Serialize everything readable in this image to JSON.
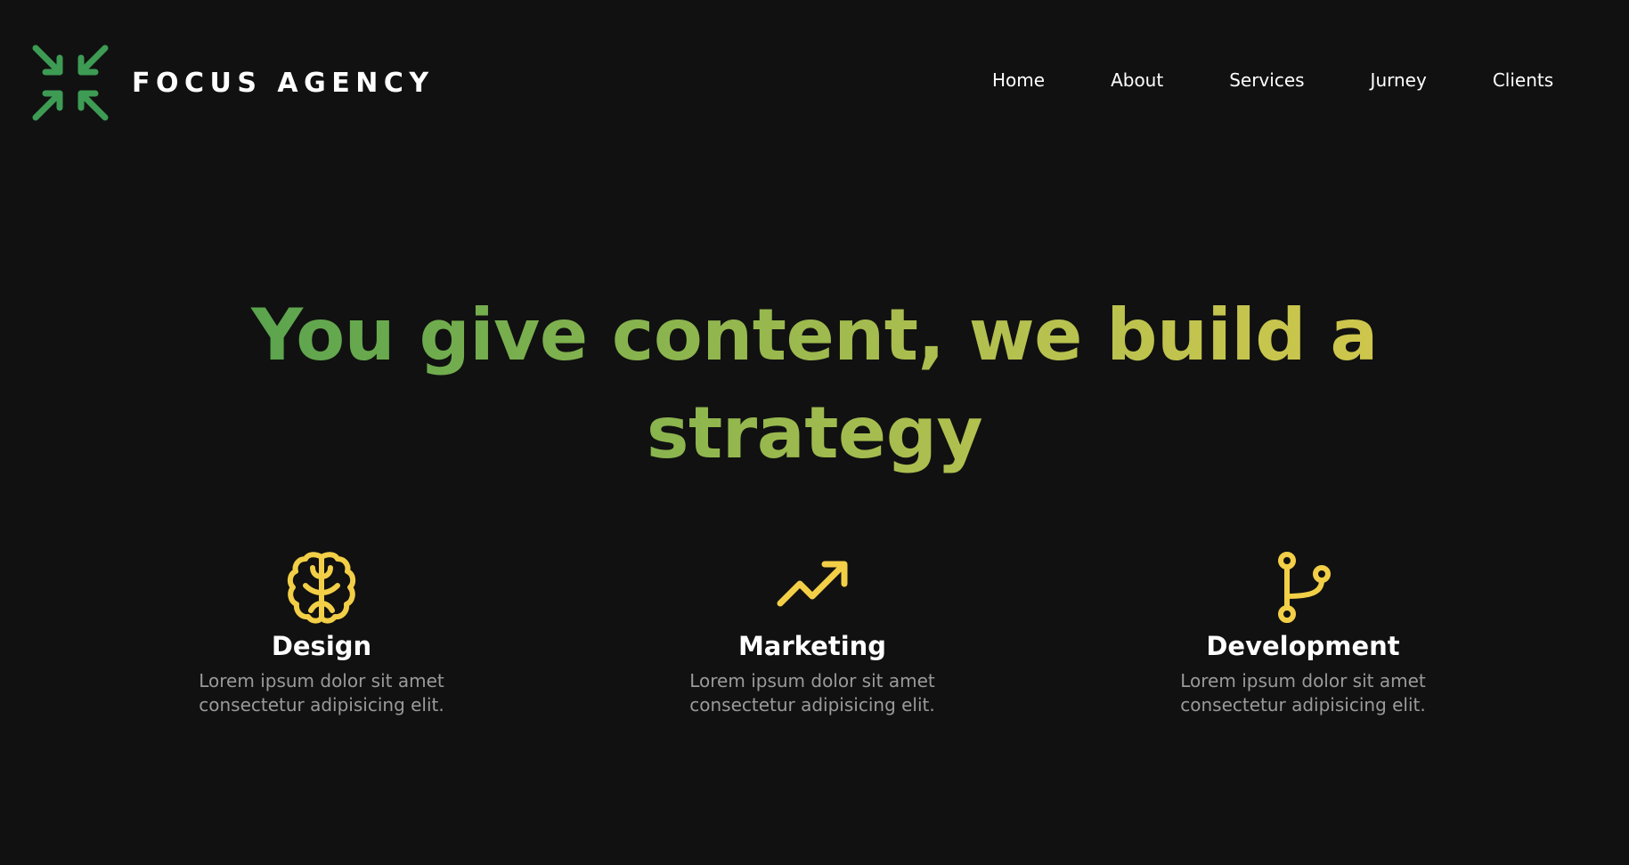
{
  "brand": {
    "name": "FOCUS AGENCY",
    "logo_icon": "compress-arrows-icon",
    "logo_color": "#3d9b54"
  },
  "nav": {
    "items": [
      {
        "label": "Home"
      },
      {
        "label": "About"
      },
      {
        "label": "Services"
      },
      {
        "label": "Jurney"
      },
      {
        "label": "Clients"
      }
    ]
  },
  "hero": {
    "title_line1": "You give content, we build a",
    "title_line2": "strategy",
    "gradient_colors": [
      "#3e9a4e",
      "#e0cb4b"
    ]
  },
  "services": [
    {
      "icon": "brain-icon",
      "title": "Design",
      "desc_line1": "Lorem ipsum dolor sit amet",
      "desc_line2": "consectetur adipisicing elit."
    },
    {
      "icon": "trending-up-icon",
      "title": "Marketing",
      "desc_line1": "Lorem ipsum dolor sit amet",
      "desc_line2": "consectetur adipisicing elit."
    },
    {
      "icon": "git-branch-icon",
      "title": "Development",
      "desc_line1": "Lorem ipsum dolor sit amet",
      "desc_line2": "consectetur adipisicing elit."
    }
  ],
  "colors": {
    "background": "#111111",
    "icon_accent": "#f2cf47",
    "muted_text": "#9a9a9a"
  }
}
